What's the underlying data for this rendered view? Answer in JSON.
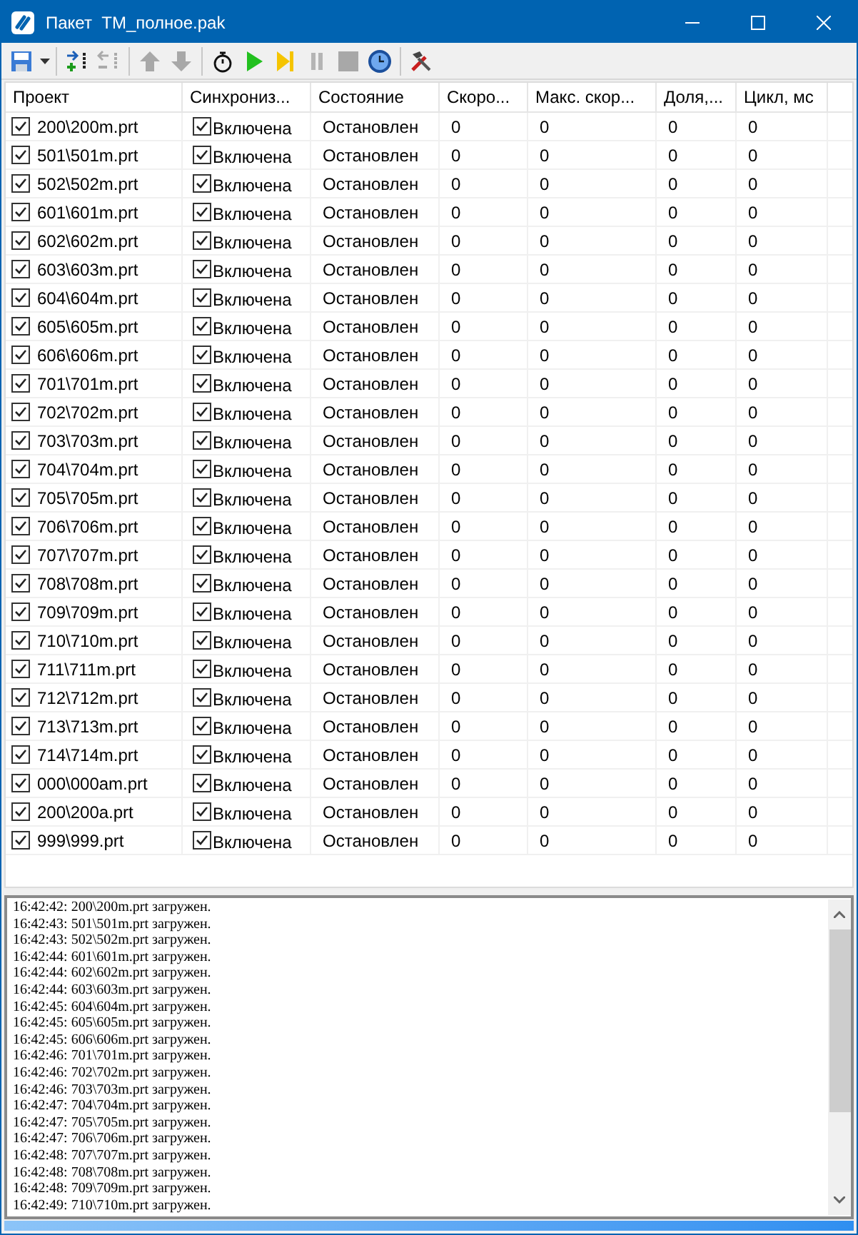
{
  "window": {
    "title": "Пакет  TM_полное.pak"
  },
  "table": {
    "columns": [
      "Проект",
      "Синхрониз...",
      "Состояние",
      "Скоро...",
      "Макс. скор...",
      "Доля,...",
      "Цикл, мс"
    ],
    "rows": [
      {
        "project": "200\\200m.prt",
        "checked": true,
        "sync_checked": true,
        "sync": "Включена",
        "state": "Остановлен",
        "values": [
          "0",
          "0",
          "0",
          "0"
        ]
      },
      {
        "project": "501\\501m.prt",
        "checked": true,
        "sync_checked": true,
        "sync": "Включена",
        "state": "Остановлен",
        "values": [
          "0",
          "0",
          "0",
          "0"
        ]
      },
      {
        "project": "502\\502m.prt",
        "checked": true,
        "sync_checked": true,
        "sync": "Включена",
        "state": "Остановлен",
        "values": [
          "0",
          "0",
          "0",
          "0"
        ]
      },
      {
        "project": "601\\601m.prt",
        "checked": true,
        "sync_checked": true,
        "sync": "Включена",
        "state": "Остановлен",
        "values": [
          "0",
          "0",
          "0",
          "0"
        ]
      },
      {
        "project": "602\\602m.prt",
        "checked": true,
        "sync_checked": true,
        "sync": "Включена",
        "state": "Остановлен",
        "values": [
          "0",
          "0",
          "0",
          "0"
        ]
      },
      {
        "project": "603\\603m.prt",
        "checked": true,
        "sync_checked": true,
        "sync": "Включена",
        "state": "Остановлен",
        "values": [
          "0",
          "0",
          "0",
          "0"
        ]
      },
      {
        "project": "604\\604m.prt",
        "checked": true,
        "sync_checked": true,
        "sync": "Включена",
        "state": "Остановлен",
        "values": [
          "0",
          "0",
          "0",
          "0"
        ]
      },
      {
        "project": "605\\605m.prt",
        "checked": true,
        "sync_checked": true,
        "sync": "Включена",
        "state": "Остановлен",
        "values": [
          "0",
          "0",
          "0",
          "0"
        ]
      },
      {
        "project": "606\\606m.prt",
        "checked": true,
        "sync_checked": true,
        "sync": "Включена",
        "state": "Остановлен",
        "values": [
          "0",
          "0",
          "0",
          "0"
        ]
      },
      {
        "project": "701\\701m.prt",
        "checked": true,
        "sync_checked": true,
        "sync": "Включена",
        "state": "Остановлен",
        "values": [
          "0",
          "0",
          "0",
          "0"
        ]
      },
      {
        "project": "702\\702m.prt",
        "checked": true,
        "sync_checked": true,
        "sync": "Включена",
        "state": "Остановлен",
        "values": [
          "0",
          "0",
          "0",
          "0"
        ]
      },
      {
        "project": "703\\703m.prt",
        "checked": true,
        "sync_checked": true,
        "sync": "Включена",
        "state": "Остановлен",
        "values": [
          "0",
          "0",
          "0",
          "0"
        ]
      },
      {
        "project": "704\\704m.prt",
        "checked": true,
        "sync_checked": true,
        "sync": "Включена",
        "state": "Остановлен",
        "values": [
          "0",
          "0",
          "0",
          "0"
        ]
      },
      {
        "project": "705\\705m.prt",
        "checked": true,
        "sync_checked": true,
        "sync": "Включена",
        "state": "Остановлен",
        "values": [
          "0",
          "0",
          "0",
          "0"
        ]
      },
      {
        "project": "706\\706m.prt",
        "checked": true,
        "sync_checked": true,
        "sync": "Включена",
        "state": "Остановлен",
        "values": [
          "0",
          "0",
          "0",
          "0"
        ]
      },
      {
        "project": "707\\707m.prt",
        "checked": true,
        "sync_checked": true,
        "sync": "Включена",
        "state": "Остановлен",
        "values": [
          "0",
          "0",
          "0",
          "0"
        ]
      },
      {
        "project": "708\\708m.prt",
        "checked": true,
        "sync_checked": true,
        "sync": "Включена",
        "state": "Остановлен",
        "values": [
          "0",
          "0",
          "0",
          "0"
        ]
      },
      {
        "project": "709\\709m.prt",
        "checked": true,
        "sync_checked": true,
        "sync": "Включена",
        "state": "Остановлен",
        "values": [
          "0",
          "0",
          "0",
          "0"
        ]
      },
      {
        "project": "710\\710m.prt",
        "checked": true,
        "sync_checked": true,
        "sync": "Включена",
        "state": "Остановлен",
        "values": [
          "0",
          "0",
          "0",
          "0"
        ]
      },
      {
        "project": "711\\711m.prt",
        "checked": true,
        "sync_checked": true,
        "sync": "Включена",
        "state": "Остановлен",
        "values": [
          "0",
          "0",
          "0",
          "0"
        ]
      },
      {
        "project": "712\\712m.prt",
        "checked": true,
        "sync_checked": true,
        "sync": "Включена",
        "state": "Остановлен",
        "values": [
          "0",
          "0",
          "0",
          "0"
        ]
      },
      {
        "project": "713\\713m.prt",
        "checked": true,
        "sync_checked": true,
        "sync": "Включена",
        "state": "Остановлен",
        "values": [
          "0",
          "0",
          "0",
          "0"
        ]
      },
      {
        "project": "714\\714m.prt",
        "checked": true,
        "sync_checked": true,
        "sync": "Включена",
        "state": "Остановлен",
        "values": [
          "0",
          "0",
          "0",
          "0"
        ]
      },
      {
        "project": "000\\000am.prt",
        "checked": true,
        "sync_checked": true,
        "sync": "Включена",
        "state": "Остановлен",
        "values": [
          "0",
          "0",
          "0",
          "0"
        ]
      },
      {
        "project": "200\\200a.prt",
        "checked": true,
        "sync_checked": true,
        "sync": "Включена",
        "state": "Остановлен",
        "values": [
          "0",
          "0",
          "0",
          "0"
        ]
      },
      {
        "project": "999\\999.prt",
        "checked": true,
        "sync_checked": true,
        "sync": "Включена",
        "state": "Остановлен",
        "values": [
          "0",
          "0",
          "0",
          "0"
        ]
      }
    ]
  },
  "log": [
    "16:42:42: 200\\200m.prt загружен.",
    "16:42:43: 501\\501m.prt загружен.",
    "16:42:43: 502\\502m.prt загружен.",
    "16:42:44: 601\\601m.prt загружен.",
    "16:42:44: 602\\602m.prt загружен.",
    "16:42:44: 603\\603m.prt загружен.",
    "16:42:45: 604\\604m.prt загружен.",
    "16:42:45: 605\\605m.prt загружен.",
    "16:42:45: 606\\606m.prt загружен.",
    "16:42:46: 701\\701m.prt загружен.",
    "16:42:46: 702\\702m.prt загружен.",
    "16:42:46: 703\\703m.prt загружен.",
    "16:42:47: 704\\704m.prt загружен.",
    "16:42:47: 705\\705m.prt загружен.",
    "16:42:47: 706\\706m.prt загружен.",
    "16:42:48: 707\\707m.prt загружен.",
    "16:42:48: 708\\708m.prt загружен.",
    "16:42:48: 709\\709m.prt загружен.",
    "16:42:49: 710\\710m.prt загружен."
  ],
  "progress": {
    "level": 1
  }
}
